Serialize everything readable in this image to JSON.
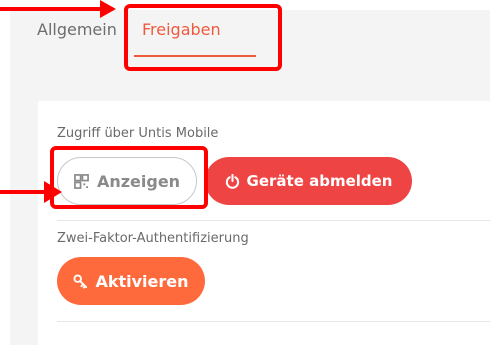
{
  "tabs": {
    "general": "Allgemein",
    "shares": "Freigaben"
  },
  "sections": {
    "access_label": "Zugriff über Untis Mobile",
    "show_label": "Anzeigen",
    "logout_label": "Geräte abmelden",
    "twofa_label": "Zwei-Faktor-Authentifizierung",
    "activate_label": "Aktivieren"
  },
  "icons": {
    "show": "qr-code-icon",
    "logout": "power-icon",
    "activate": "key-icon"
  },
  "colors": {
    "accent": "#ef5a3d",
    "logout_bg": "#ef4444",
    "activate_bg": "#ff6a3d",
    "annotation": "#ff0000"
  }
}
